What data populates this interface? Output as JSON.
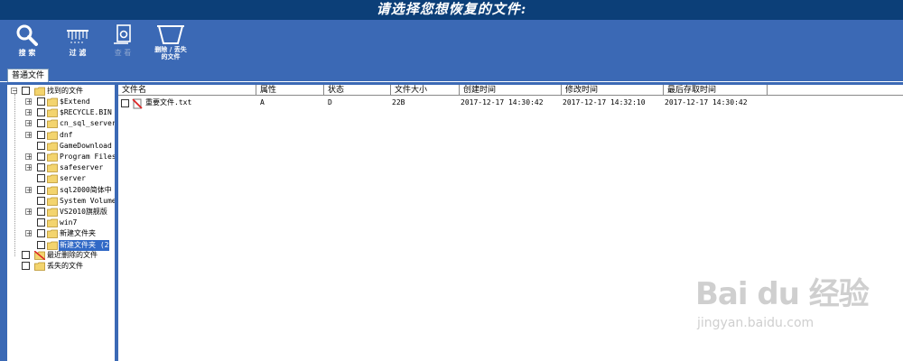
{
  "header": {
    "title": "请选择您想恢复的文件:"
  },
  "toolbar": {
    "search": "搜 索",
    "filter": "过 滤",
    "view": "查 看",
    "delete_line1": "删除 / 丢失",
    "delete_line2": "的文件"
  },
  "tab": {
    "label": "普通文件"
  },
  "tree": {
    "root": "找到的文件",
    "items": [
      "$Extend",
      "$RECYCLE.BIN",
      "cn_sql_server",
      "dnf",
      "GameDownload",
      "Program Files",
      "safeserver",
      "server",
      "sql2000简体中",
      "System Volume",
      "VS2010旗舰版",
      "win7",
      "新建文件夹",
      "新建文件夹 (2"
    ],
    "recent_deleted": "最近删除的文件",
    "lost": "丢失的文件"
  },
  "columns": [
    "文件名",
    "属性",
    "状态",
    "文件大小",
    "创建时间",
    "修改时间",
    "最后存取时间"
  ],
  "rows": [
    {
      "name": "重要文件.txt",
      "attr": "A",
      "status": "D",
      "size": "22B",
      "created": "2017-12-17 14:30:42",
      "modified": "2017-12-17 14:32:10",
      "accessed": "2017-12-17 14:30:42"
    }
  ],
  "watermark": {
    "brand": "Bai du 经验",
    "site": "jingyan.baidu.com"
  },
  "colors": {
    "header": "#0c3f78",
    "toolbar": "#3b69b5",
    "selection": "#3169c6",
    "folder": "#f3d46e"
  }
}
